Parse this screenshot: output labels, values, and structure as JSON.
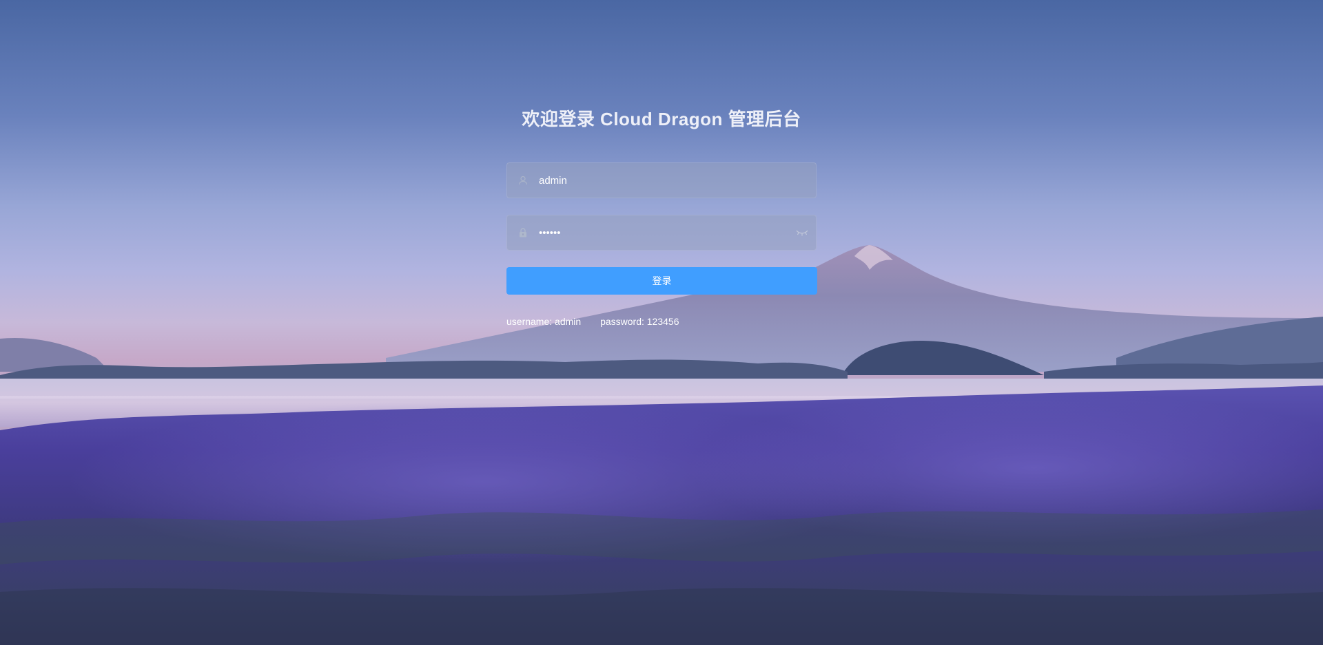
{
  "title": "欢迎登录 Cloud Dragon 管理后台",
  "username_field": {
    "value": "admin",
    "icon": "user-icon"
  },
  "password_field": {
    "value": "123456",
    "icon": "lock-icon",
    "toggle_icon": "eye-closed-icon"
  },
  "login_button": {
    "label": "登录"
  },
  "hint": {
    "username": "username: admin",
    "password": "password: 123456"
  },
  "colors": {
    "primary_button": "#409eff",
    "input_background": "#96a0c0",
    "title_text": "#eef0f8"
  },
  "background": {
    "description_icon": "lavender-field-mountain-background"
  }
}
